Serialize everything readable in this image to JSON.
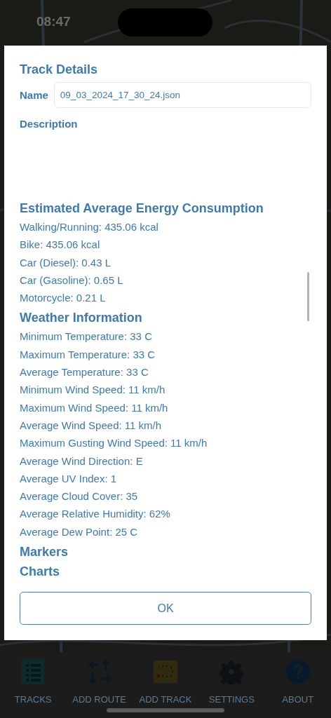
{
  "status_bar": {
    "time": "08:47"
  },
  "dialog": {
    "title": "Track Details",
    "name_label": "Name",
    "name_value": "09_03_2024_17_30_24.json",
    "description_label": "Description",
    "sections": [
      {
        "title": "Estimated Average Energy Consumption",
        "lines": [
          "Walking/Running: 435.06 kcal",
          "Bike: 435.06 kcal",
          "Car (Diesel): 0.43 L",
          "Car (Gasoline): 0.65 L",
          "Motorcycle: 0.21 L"
        ]
      },
      {
        "title": "Weather Information",
        "lines": [
          "Minimum Temperature: 33 C",
          "Maximum Temperature: 33 C",
          "Average Temperature: 33 C",
          "Minimum Wind Speed: 11 km/h",
          "Maximum Wind Speed: 11 km/h",
          "Average Wind Speed: 11 km/h",
          "Maximum Gusting Wind Speed: 11 km/h",
          "Average Wind Direction: E",
          "Average UV Index: 1",
          "Average Cloud Cover: 35",
          "Average Relative Humidity: 62%",
          "Average Dew Point: 25 C"
        ]
      },
      {
        "title": "Markers"
      },
      {
        "title": "Charts"
      }
    ],
    "ok_button": "OK"
  },
  "tab_bar": [
    {
      "label": "TRACKS",
      "kind": "list"
    },
    {
      "label": "ADD ROUTE",
      "kind": "arrows"
    },
    {
      "label": "ADD TRACK",
      "kind": "map"
    },
    {
      "label": "SETTINGS",
      "kind": "gear"
    },
    {
      "label": "ABOUT",
      "kind": "help"
    }
  ]
}
